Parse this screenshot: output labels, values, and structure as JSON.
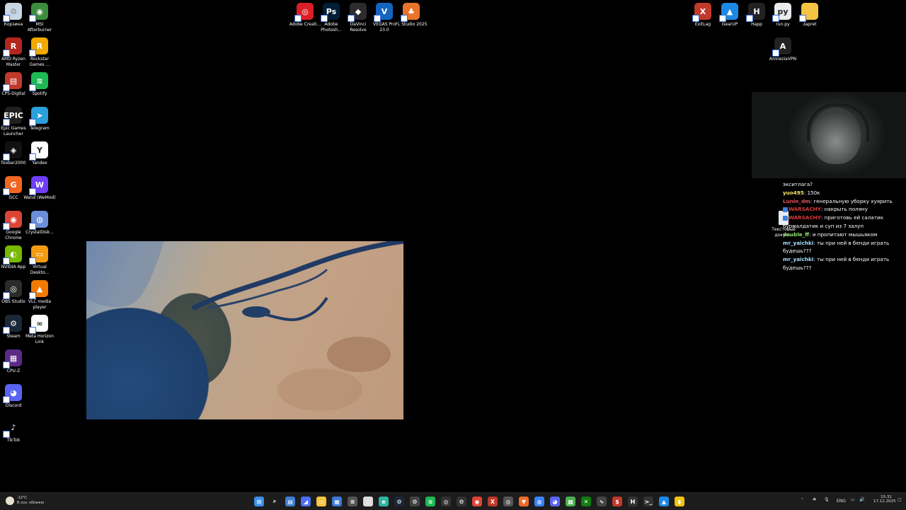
{
  "desktop_left": [
    {
      "label": "Корзина",
      "icon": "recycle-bin-icon",
      "color": "#c9d6e3",
      "glyph": "♲"
    },
    {
      "label": "MSI Afterburner",
      "icon": "msi-afterburner-icon",
      "color": "#3c8d3c",
      "glyph": "◉"
    },
    {
      "label": "AMD Ryzen Master",
      "icon": "amd-ryzen-master-icon",
      "color": "#b3261e",
      "glyph": "R"
    },
    {
      "label": "Rockstar Games ...",
      "icon": "rockstar-icon",
      "color": "#f2a900",
      "glyph": "R"
    },
    {
      "label": "CPS-Digital",
      "icon": "cps-digital-icon",
      "color": "#c0392b",
      "glyph": "▤"
    },
    {
      "label": "Spotify",
      "icon": "spotify-icon",
      "color": "#1db954",
      "glyph": "≋"
    },
    {
      "label": "Epic Games Launcher",
      "icon": "epic-games-icon",
      "color": "#202020",
      "glyph": "EPIC"
    },
    {
      "label": "Telegram",
      "icon": "telegram-icon",
      "color": "#2aa1da",
      "glyph": "➤"
    },
    {
      "label": "foobar2000",
      "icon": "foobar2000-icon",
      "color": "#111111",
      "glyph": "◈"
    },
    {
      "label": "Yandex",
      "icon": "yandex-browser-icon",
      "color": "#ffffff",
      "glyph": "Y"
    },
    {
      "label": "GCC",
      "icon": "gcc-icon",
      "color": "#f26522",
      "glyph": "G"
    },
    {
      "label": "Wand (WeMod)",
      "icon": "wand-icon",
      "color": "#6f3ef5",
      "glyph": "W"
    },
    {
      "label": "Google Chrome",
      "icon": "chrome-icon",
      "color": "#db4437",
      "glyph": "◉"
    },
    {
      "label": "CrystalDisk...",
      "icon": "crystaldisk-icon",
      "color": "#6a8fd8",
      "glyph": "◍"
    },
    {
      "label": "NVIDIA App",
      "icon": "nvidia-icon",
      "color": "#76b900",
      "glyph": "◐"
    },
    {
      "label": "Virtual Deskto...",
      "icon": "virtual-desktop-icon",
      "color": "#f39c12",
      "glyph": "▭"
    },
    {
      "label": "OBS Studio",
      "icon": "obs-icon",
      "color": "#2b2b2b",
      "glyph": "◎"
    },
    {
      "label": "VLC media player",
      "icon": "vlc-icon",
      "color": "#f27a00",
      "glyph": "▲"
    },
    {
      "label": "Steam",
      "icon": "steam-icon",
      "color": "#1b2838",
      "glyph": "⚙"
    },
    {
      "label": "Meta Horizon Link",
      "icon": "meta-horizon-icon",
      "color": "#ffffff",
      "glyph": "∞"
    },
    {
      "label": "CPU-Z",
      "icon": "cpu-z-icon",
      "color": "#5b2a86",
      "glyph": "▦"
    },
    {
      "label": "Discord",
      "icon": "discord-icon",
      "color": "#5865f2",
      "glyph": "◕"
    },
    {
      "label": "TikTok",
      "icon": "tiktok-icon",
      "color": "#000000",
      "glyph": "♪"
    }
  ],
  "desktop_top": [
    {
      "label": "Adobe Creati...",
      "icon": "adobe-cc-icon",
      "color": "#da1f26",
      "glyph": "◎"
    },
    {
      "label": "Adobe Photosh...",
      "icon": "photoshop-icon",
      "color": "#001e36",
      "glyph": "Ps"
    },
    {
      "label": "DaVinci Resolve",
      "icon": "davinci-icon",
      "color": "#2c2c2c",
      "glyph": "◆"
    },
    {
      "label": "VEGAS Pro 23.0",
      "icon": "vegas-icon",
      "color": "#1565c0",
      "glyph": "V"
    },
    {
      "label": "FL Studio 2025",
      "icon": "fl-studio-icon",
      "color": "#e8742b",
      "glyph": "♣"
    }
  ],
  "desktop_right": [
    {
      "label": "ExitLag",
      "icon": "exitlag-icon",
      "color": "#c0392b",
      "glyph": "X"
    },
    {
      "label": "GearUP",
      "icon": "gearup-icon",
      "color": "#1e88e5",
      "glyph": "▲"
    },
    {
      "label": "Happ",
      "icon": "happ-icon",
      "color": "#222222",
      "glyph": "H"
    },
    {
      "label": "run.py",
      "icon": "python-file-icon",
      "color": "#e9ecef",
      "glyph": "py"
    },
    {
      "label": "zapret",
      "icon": "folder-icon",
      "color": "#f4c542",
      "glyph": ""
    },
    {
      "label": "AmneziaVPN",
      "icon": "amneziavpn-icon",
      "color": "#222222",
      "glyph": "A"
    }
  ],
  "hidden_icon_label": "Текстовый докум...",
  "chat": [
    {
      "user": "",
      "user_color": "#ffffff",
      "text": "экситлага?"
    },
    {
      "user": "yuo495",
      "user_color": "#f5e26b",
      "text": "150к"
    },
    {
      "user": "Lunin_dm",
      "user_color": "#e0525a",
      "text": "генеральную уборку хуярить"
    },
    {
      "user": "WARSACHY",
      "user_color": "#d33d3d",
      "text": "накрыть поляну",
      "badge": true
    },
    {
      "user": "WARSACHY",
      "user_color": "#d33d3d",
      "text": "приготовь ей салатик бурмалдатик и суп из 7 залуп",
      "badge": true
    },
    {
      "user": "double_ff",
      "user_color": "#8fe36b",
      "text": "и пропитают мышьяком"
    },
    {
      "user": "mr_yaichki",
      "user_color": "#a6e0ff",
      "text": "ты при ней в бенди играть будешь???"
    },
    {
      "user": "mr_yaichki",
      "user_color": "#a6e0ff",
      "text": "ты при ней в бенди играть будешь???"
    }
  ],
  "weather": {
    "temp": "-12°C",
    "desc": "В осн. облачно"
  },
  "taskbar_apps": [
    {
      "icon": "start-icon",
      "color": "#3c8ee8",
      "glyph": "⊞"
    },
    {
      "icon": "search-icon",
      "color": "transparent",
      "glyph": "⌕"
    },
    {
      "icon": "widgets-icon",
      "color": "#3f7fd1",
      "glyph": "▤"
    },
    {
      "icon": "taskbar-app-2-icon",
      "color": "#4c6ef5",
      "glyph": "◢"
    },
    {
      "icon": "file-explorer-icon",
      "color": "#f4c542",
      "glyph": "▭"
    },
    {
      "icon": "store-icon",
      "color": "#3b78d8",
      "glyph": "▦"
    },
    {
      "icon": "wand-taskbar-icon",
      "color": "#555555",
      "glyph": "≡"
    },
    {
      "icon": "clipboard-icon",
      "color": "#dddddd",
      "glyph": "▯"
    },
    {
      "icon": "edge-icon",
      "color": "#2fb4a0",
      "glyph": "e"
    },
    {
      "icon": "steam-taskbar-icon",
      "color": "#1b2838",
      "glyph": "⚙"
    },
    {
      "icon": "settings-icon",
      "color": "#444444",
      "glyph": "⚙"
    },
    {
      "icon": "spotify-taskbar-icon",
      "color": "#1db954",
      "glyph": "≋"
    },
    {
      "icon": "chatgpt-icon",
      "color": "#333333",
      "glyph": "◎"
    },
    {
      "icon": "gear-taskbar-icon",
      "color": "#333333",
      "glyph": "⚙"
    },
    {
      "icon": "chrome-taskbar-icon",
      "color": "#db4437",
      "glyph": "◉"
    },
    {
      "icon": "exitlag-taskbar-icon",
      "color": "#c0392b",
      "glyph": "X"
    },
    {
      "icon": "obs-taskbar-icon",
      "color": "#555555",
      "glyph": "◎"
    },
    {
      "icon": "brave-icon",
      "color": "#f06b2b",
      "glyph": "▼"
    },
    {
      "icon": "globe-icon",
      "color": "#3b82f6",
      "glyph": "◍"
    },
    {
      "icon": "discord-taskbar-icon",
      "color": "#5865f2",
      "glyph": "◕"
    },
    {
      "icon": "minecraft-icon",
      "color": "#4caf50",
      "glyph": "▩"
    },
    {
      "icon": "xbox-icon",
      "color": "#107c10",
      "glyph": "✕"
    },
    {
      "icon": "razer-icon",
      "color": "#444444",
      "glyph": "∿"
    },
    {
      "icon": "app-s-icon",
      "color": "#c0392b",
      "glyph": "$"
    },
    {
      "icon": "happ-taskbar-icon",
      "color": "#333333",
      "glyph": "H"
    },
    {
      "icon": "terminal-icon",
      "color": "#333333",
      "glyph": ">_"
    },
    {
      "icon": "gearup-taskbar-icon",
      "color": "#1e88e5",
      "glyph": "▲"
    },
    {
      "icon": "notes-icon",
      "color": "#f1c40f",
      "glyph": "▮"
    }
  ],
  "tray": {
    "lang": "ENG",
    "time": "15:31",
    "date": "17.12.2025"
  }
}
